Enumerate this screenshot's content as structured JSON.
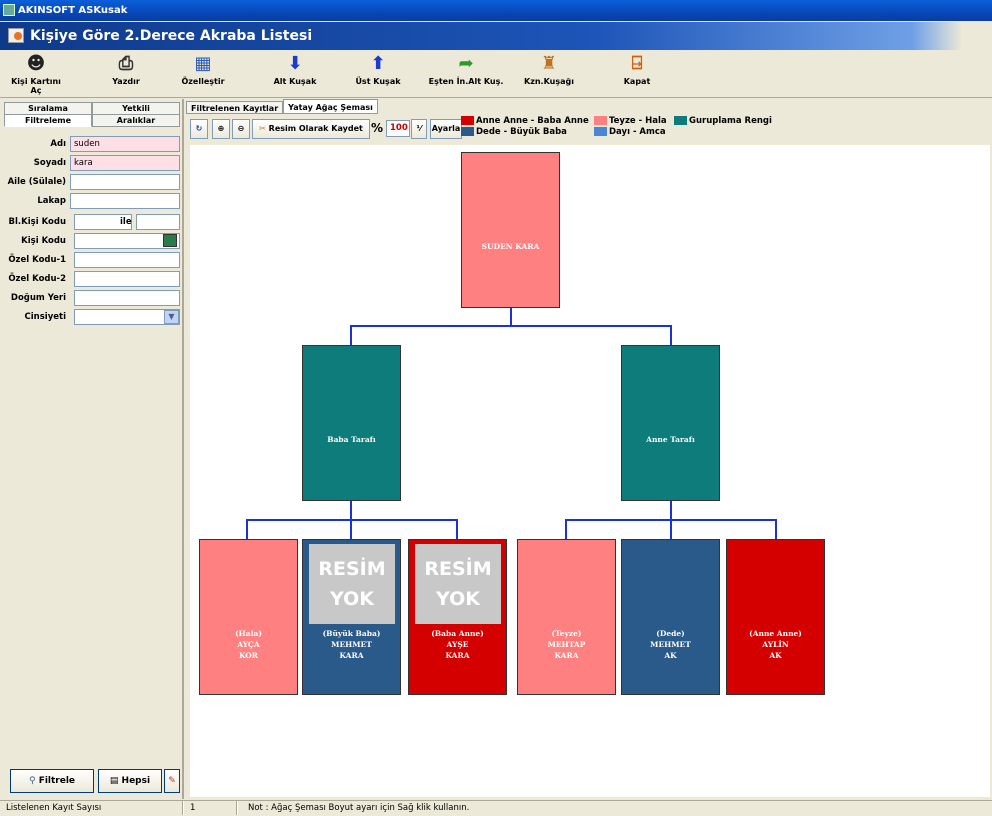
{
  "app_title": "AKINSOFT ASKusak",
  "header_title": "Kişiye Göre 2.Derece Akraba Listesi",
  "toolbar": [
    {
      "label": "Kişi Kartını Aç",
      "icon": "person-card-icon"
    },
    {
      "label": "Yazdır",
      "icon": "printer-icon"
    },
    {
      "label": "Özelleştir",
      "icon": "grid-icon"
    },
    {
      "label": "Alt Kuşak",
      "icon": "arrow-down-icon"
    },
    {
      "label": "Üst Kuşak",
      "icon": "arrow-up-icon"
    },
    {
      "label": "Eşten İn.Alt Kuş.",
      "icon": "green-arrow-icon"
    },
    {
      "label": "Kzn.Kuşağı",
      "icon": "family-icon"
    },
    {
      "label": "Kapat",
      "icon": "exit-icon"
    }
  ],
  "left_tabs": {
    "row1": [
      "Sıralama",
      "Yetkili"
    ],
    "row2": [
      "Filtreleme",
      "Aralıklar"
    ]
  },
  "filters": {
    "adi": {
      "label": "Adı",
      "value": "suden"
    },
    "soyadi": {
      "label": "Soyadı",
      "value": "kara"
    },
    "aile": {
      "label": "Aile (Sülale)",
      "value": ""
    },
    "lakap": {
      "label": "Lakap",
      "value": ""
    },
    "bl_kisi_kodu": {
      "label": "Bl.Kişi Kodu",
      "value": "",
      "ile": "ile",
      "value2": ""
    },
    "kisi_kodu": {
      "label": "Kişi Kodu",
      "value": ""
    },
    "ozel_kodu_1": {
      "label": "Özel Kodu-1",
      "value": ""
    },
    "ozel_kodu_2": {
      "label": "Özel Kodu-2",
      "value": ""
    },
    "dogum_yeri": {
      "label": "Doğum Yeri",
      "value": ""
    },
    "cinsiyeti": {
      "label": "Cinsiyeti",
      "value": ""
    }
  },
  "bottom_buttons": {
    "filtrele": "Filtrele",
    "hepsi": "Hepsi"
  },
  "right_tabs": [
    "Filtrelenen Kayıtlar",
    "Yatay Ağaç Şeması"
  ],
  "tree_toolbar": {
    "save_as_image": "Resim Olarak Kaydet",
    "percent_sign": "%",
    "zoom_value": "100",
    "adjust": "Ayarla"
  },
  "legend": [
    {
      "label": "Anne Anne - Baba Anne",
      "color": "#d40000"
    },
    {
      "label": "Dede - Büyük Baba",
      "color": "#2a5a8a"
    },
    {
      "label": "Teyze - Hala",
      "color": "#ff8080"
    },
    {
      "label": "Dayı - Amca",
      "color": "#4a86d8"
    },
    {
      "label": "Guruplama Rengi",
      "color": "#0e7c7b"
    }
  ],
  "tree": {
    "root": {
      "name": "SUDEN KARA",
      "color": "#ff8080"
    },
    "groups": [
      {
        "name": "Baba Tarafı",
        "color": "#0e7c7b"
      },
      {
        "name": "Anne Tarafı",
        "color": "#0e7c7b"
      }
    ],
    "no_image": [
      "RESİM",
      "YOK"
    ],
    "leaves": [
      {
        "role": "(Hala)",
        "first": "AYÇA",
        "last": "KOR",
        "color": "#ff8080",
        "no_image": false
      },
      {
        "role": "(Büyük Baba)",
        "first": "MEHMET",
        "last": "KARA",
        "color": "#2a5a8a",
        "no_image": true
      },
      {
        "role": "(Baba Anne)",
        "first": "AYŞE",
        "last": "KARA",
        "color": "#d40000",
        "no_image": true
      },
      {
        "role": "(Teyze)",
        "first": "MEHTAP",
        "last": "KARA",
        "color": "#ff8080",
        "no_image": false
      },
      {
        "role": "(Dede)",
        "first": "MEHMET",
        "last": "AK",
        "color": "#2a5a8a",
        "no_image": false
      },
      {
        "role": "(Anne Anne)",
        "first": "AYLİN",
        "last": "AK",
        "color": "#d40000",
        "no_image": false
      }
    ]
  },
  "status": {
    "label": "Listelenen Kayıt Sayısı",
    "count": "1",
    "note": "Not : Ağaç Şeması Boyut ayarı için Sağ klik kullanın."
  }
}
